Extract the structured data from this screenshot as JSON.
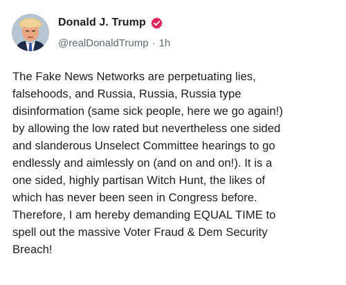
{
  "author": {
    "display_name": "Donald J. Trump",
    "handle": "@realDonaldTrump",
    "separator": "·",
    "time": "1h",
    "avatar_icon": "profile-photo-avatar",
    "verified_icon": "verified-badge-icon",
    "verified_color": "#e0245e"
  },
  "post": {
    "text": "The Fake News Networks are perpetuating lies,\nfalsehoods, and Russia, Russia, Russia type\ndisinformation (same sick people, here we go again!)\nby allowing the low rated but nevertheless one sided\nand slanderous Unselect Committee hearings to go\nendlessly and aimlessly on (and on and on!). It is a\none sided, highly partisan Witch Hunt, the likes of\nwhich has never been seen in Congress before.\nTherefore, I am hereby demanding EQUAL TIME to\nspell out the massive Voter Fraud & Dem Security\nBreach!"
  }
}
